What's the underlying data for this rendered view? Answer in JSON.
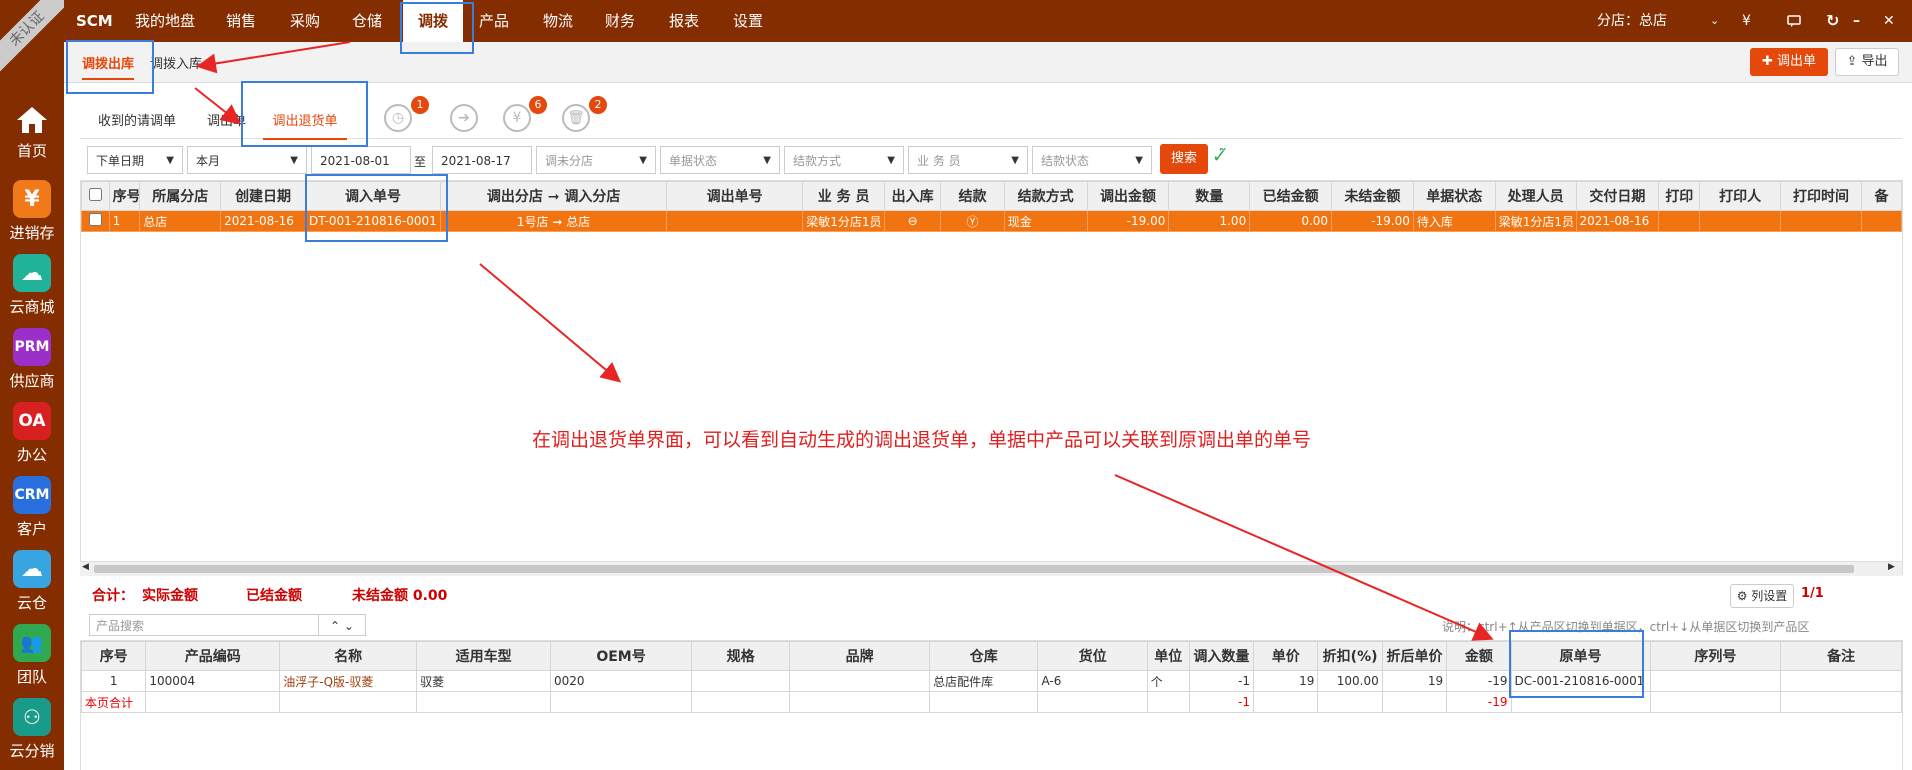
{
  "sidebar": {
    "ribbon": "未认证",
    "items": [
      {
        "label": "首页",
        "icon": "home-icon"
      },
      {
        "label": "进销存",
        "icon": "yen-icon",
        "glyph": "¥",
        "color": "#f07a1a"
      },
      {
        "label": "云商城",
        "icon": "cloud-shop-icon",
        "glyph": "☁",
        "color": "#20b39a"
      },
      {
        "label": "供应商",
        "icon": "prm-icon",
        "glyph": "PRM",
        "color": "#9c2fc9"
      },
      {
        "label": "办公",
        "icon": "oa-icon",
        "glyph": "OA",
        "color": "#d92020"
      },
      {
        "label": "客户",
        "icon": "crm-icon",
        "glyph": "CRM",
        "color": "#2a6fe0"
      },
      {
        "label": "云仓",
        "icon": "cloud-icon",
        "glyph": "☁",
        "color": "#38a4e0"
      },
      {
        "label": "团队",
        "icon": "team-icon",
        "glyph": "👥",
        "color": "#2fa84f"
      },
      {
        "label": "云分销",
        "icon": "distribution-icon",
        "glyph": "⚇",
        "color": "#1a9a8a"
      }
    ]
  },
  "topbar": {
    "brand": "SCM",
    "menu": [
      "我的地盘",
      "销售",
      "采购",
      "仓储",
      "调拨",
      "产品",
      "物流",
      "财务",
      "报表",
      "设置"
    ],
    "active": "调拨",
    "branch": "分店：总店",
    "currency": "¥"
  },
  "subbar": {
    "tab_out": "调拨出库",
    "tab_in": "调拨入库",
    "btn_new": "调出单",
    "btn_export": "导出"
  },
  "doc_tabs": {
    "received": "收到的请调单",
    "out_order": "调出单",
    "return_order": "调出退货单",
    "badges": [
      "1",
      "6",
      "2"
    ]
  },
  "filters": {
    "date_type": "下单日期",
    "period": "本月",
    "date_from": "2021-08-01",
    "to": "至",
    "date_to": "2021-08-17",
    "in_branch": "调未分店",
    "doc_status": "单据状态",
    "settle_method": "结款方式",
    "salesman": "业 务 员",
    "settle_status": "结款状态",
    "search": "搜索"
  },
  "main_table": {
    "headers": [
      "序号",
      "所属分店",
      "创建日期",
      "调入单号",
      "调出分店 ➞ 调入分店",
      "调出单号",
      "业 务 员",
      "出入库",
      "结款",
      "结款方式",
      "调出金额",
      "数量",
      "已结金额",
      "未结金额",
      "单据状态",
      "处理人员",
      "交付日期",
      "打印",
      "打印人",
      "打印时间",
      "备"
    ],
    "rows": [
      {
        "seq": "1",
        "branch": "总店",
        "created": "2021-08-16",
        "in_no": "DT-001-210816-0001",
        "from": "1号店",
        "arrow": "➞",
        "to": "总店",
        "out_no": "",
        "salesman": "梁敏1分店1员",
        "method": "现金",
        "amount": "-19.00",
        "qty": "1.00",
        "settled": "0.00",
        "unsettled": "-19.00",
        "status": "待入库",
        "handler": "梁敏1分店1员",
        "delivery": "2021-08-16",
        "print": "",
        "printer": "",
        "print_time": ""
      }
    ]
  },
  "annotation": "在调出退货单界面，可以看到自动生成的调出退货单，单据中产品可以关联到原调出单的单号",
  "summary": {
    "total": "合计：",
    "actual": "实际金额",
    "settled": "已结金额",
    "unsettled": "未结金额 0.00",
    "col_settings": "列设置",
    "page": "1/1"
  },
  "product_search": {
    "placeholder": "产品搜索",
    "hint": "说明：ctrl+↑从产品区切换到单据区，ctrl+↓从单据区切换到产品区"
  },
  "detail_table": {
    "headers": [
      "序号",
      "产品编码",
      "名称",
      "适用车型",
      "OEM号",
      "规格",
      "品牌",
      "仓库",
      "货位",
      "单位",
      "调入数量",
      "单价",
      "折扣(%)",
      "折后单价",
      "金额",
      "原单号",
      "序列号",
      "备注"
    ],
    "rows": [
      {
        "seq": "1",
        "code": "100004",
        "name": "油浮子-Q版-驭菱",
        "model": "驭菱",
        "oem": "0020",
        "spec": "",
        "brand": "",
        "warehouse": "总店配件库",
        "location": "A-6",
        "unit": "个",
        "qty": "-1",
        "price": "19",
        "discount": "100.00",
        "disc_price": "19",
        "amount": "-19",
        "orig_no": "DC-001-210816-0001",
        "serial": "",
        "remark": ""
      }
    ],
    "total_label": "本页合计",
    "total_qty": "-1",
    "total_amount": "-19"
  }
}
